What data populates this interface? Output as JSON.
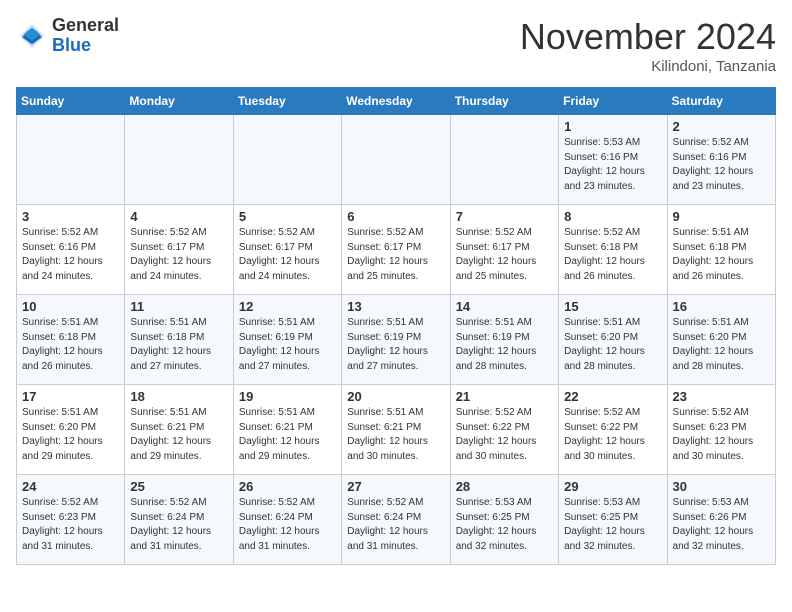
{
  "header": {
    "logo_line1": "General",
    "logo_line2": "Blue",
    "month_year": "November 2024",
    "location": "Kilindoni, Tanzania"
  },
  "weekdays": [
    "Sunday",
    "Monday",
    "Tuesday",
    "Wednesday",
    "Thursday",
    "Friday",
    "Saturday"
  ],
  "weeks": [
    [
      {
        "day": "",
        "info": ""
      },
      {
        "day": "",
        "info": ""
      },
      {
        "day": "",
        "info": ""
      },
      {
        "day": "",
        "info": ""
      },
      {
        "day": "",
        "info": ""
      },
      {
        "day": "1",
        "info": "Sunrise: 5:53 AM\nSunset: 6:16 PM\nDaylight: 12 hours and 23 minutes."
      },
      {
        "day": "2",
        "info": "Sunrise: 5:52 AM\nSunset: 6:16 PM\nDaylight: 12 hours and 23 minutes."
      }
    ],
    [
      {
        "day": "3",
        "info": "Sunrise: 5:52 AM\nSunset: 6:16 PM\nDaylight: 12 hours and 24 minutes."
      },
      {
        "day": "4",
        "info": "Sunrise: 5:52 AM\nSunset: 6:17 PM\nDaylight: 12 hours and 24 minutes."
      },
      {
        "day": "5",
        "info": "Sunrise: 5:52 AM\nSunset: 6:17 PM\nDaylight: 12 hours and 24 minutes."
      },
      {
        "day": "6",
        "info": "Sunrise: 5:52 AM\nSunset: 6:17 PM\nDaylight: 12 hours and 25 minutes."
      },
      {
        "day": "7",
        "info": "Sunrise: 5:52 AM\nSunset: 6:17 PM\nDaylight: 12 hours and 25 minutes."
      },
      {
        "day": "8",
        "info": "Sunrise: 5:52 AM\nSunset: 6:18 PM\nDaylight: 12 hours and 26 minutes."
      },
      {
        "day": "9",
        "info": "Sunrise: 5:51 AM\nSunset: 6:18 PM\nDaylight: 12 hours and 26 minutes."
      }
    ],
    [
      {
        "day": "10",
        "info": "Sunrise: 5:51 AM\nSunset: 6:18 PM\nDaylight: 12 hours and 26 minutes."
      },
      {
        "day": "11",
        "info": "Sunrise: 5:51 AM\nSunset: 6:18 PM\nDaylight: 12 hours and 27 minutes."
      },
      {
        "day": "12",
        "info": "Sunrise: 5:51 AM\nSunset: 6:19 PM\nDaylight: 12 hours and 27 minutes."
      },
      {
        "day": "13",
        "info": "Sunrise: 5:51 AM\nSunset: 6:19 PM\nDaylight: 12 hours and 27 minutes."
      },
      {
        "day": "14",
        "info": "Sunrise: 5:51 AM\nSunset: 6:19 PM\nDaylight: 12 hours and 28 minutes."
      },
      {
        "day": "15",
        "info": "Sunrise: 5:51 AM\nSunset: 6:20 PM\nDaylight: 12 hours and 28 minutes."
      },
      {
        "day": "16",
        "info": "Sunrise: 5:51 AM\nSunset: 6:20 PM\nDaylight: 12 hours and 28 minutes."
      }
    ],
    [
      {
        "day": "17",
        "info": "Sunrise: 5:51 AM\nSunset: 6:20 PM\nDaylight: 12 hours and 29 minutes."
      },
      {
        "day": "18",
        "info": "Sunrise: 5:51 AM\nSunset: 6:21 PM\nDaylight: 12 hours and 29 minutes."
      },
      {
        "day": "19",
        "info": "Sunrise: 5:51 AM\nSunset: 6:21 PM\nDaylight: 12 hours and 29 minutes."
      },
      {
        "day": "20",
        "info": "Sunrise: 5:51 AM\nSunset: 6:21 PM\nDaylight: 12 hours and 30 minutes."
      },
      {
        "day": "21",
        "info": "Sunrise: 5:52 AM\nSunset: 6:22 PM\nDaylight: 12 hours and 30 minutes."
      },
      {
        "day": "22",
        "info": "Sunrise: 5:52 AM\nSunset: 6:22 PM\nDaylight: 12 hours and 30 minutes."
      },
      {
        "day": "23",
        "info": "Sunrise: 5:52 AM\nSunset: 6:23 PM\nDaylight: 12 hours and 30 minutes."
      }
    ],
    [
      {
        "day": "24",
        "info": "Sunrise: 5:52 AM\nSunset: 6:23 PM\nDaylight: 12 hours and 31 minutes."
      },
      {
        "day": "25",
        "info": "Sunrise: 5:52 AM\nSunset: 6:24 PM\nDaylight: 12 hours and 31 minutes."
      },
      {
        "day": "26",
        "info": "Sunrise: 5:52 AM\nSunset: 6:24 PM\nDaylight: 12 hours and 31 minutes."
      },
      {
        "day": "27",
        "info": "Sunrise: 5:52 AM\nSunset: 6:24 PM\nDaylight: 12 hours and 31 minutes."
      },
      {
        "day": "28",
        "info": "Sunrise: 5:53 AM\nSunset: 6:25 PM\nDaylight: 12 hours and 32 minutes."
      },
      {
        "day": "29",
        "info": "Sunrise: 5:53 AM\nSunset: 6:25 PM\nDaylight: 12 hours and 32 minutes."
      },
      {
        "day": "30",
        "info": "Sunrise: 5:53 AM\nSunset: 6:26 PM\nDaylight: 12 hours and 32 minutes."
      }
    ]
  ]
}
